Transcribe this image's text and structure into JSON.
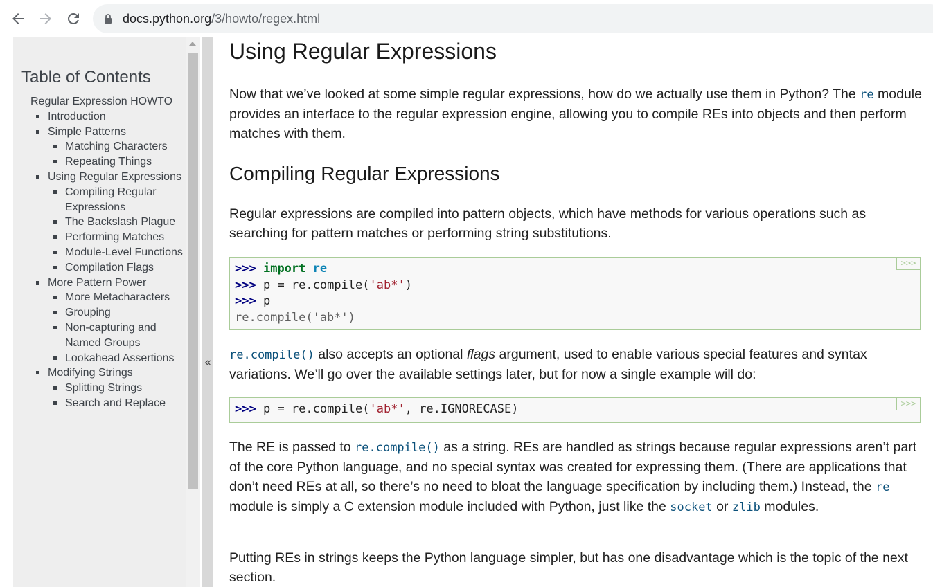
{
  "browser": {
    "url_domain": "docs.python.org",
    "url_path": "/3/howto/regex.html"
  },
  "sidebar": {
    "title": "Table of Contents",
    "items": [
      {
        "level": 0,
        "label": "Regular Expression HOWTO"
      },
      {
        "level": 1,
        "label": "Introduction"
      },
      {
        "level": 1,
        "label": "Simple Patterns"
      },
      {
        "level": 2,
        "label": "Matching Characters"
      },
      {
        "level": 2,
        "label": "Repeating Things"
      },
      {
        "level": 1,
        "label": "Using Regular Expressions"
      },
      {
        "level": 2,
        "label": "Compiling Regular Expressions"
      },
      {
        "level": 2,
        "label": "The Backslash Plague"
      },
      {
        "level": 2,
        "label": "Performing Matches"
      },
      {
        "level": 2,
        "label": "Module-Level Functions"
      },
      {
        "level": 2,
        "label": "Compilation Flags"
      },
      {
        "level": 1,
        "label": "More Pattern Power"
      },
      {
        "level": 2,
        "label": "More Metacharacters"
      },
      {
        "level": 2,
        "label": "Grouping"
      },
      {
        "level": 2,
        "label": "Non-capturing and Named Groups"
      },
      {
        "level": 2,
        "label": "Lookahead Assertions"
      },
      {
        "level": 1,
        "label": "Modifying Strings"
      },
      {
        "level": 2,
        "label": "Splitting Strings"
      },
      {
        "level": 2,
        "label": "Search and Replace"
      }
    ],
    "collapse_label": "«"
  },
  "main": {
    "h1": "Using Regular Expressions",
    "p1_before": "Now that we’ve looked at some simple regular expressions, how do we actually use them in Python? The ",
    "p1_code": "re",
    "p1_after": " module provides an interface to the regular expression engine, allowing you to compile REs into objects and then perform matches with them.",
    "h2": "Compiling Regular Expressions",
    "p2": "Regular expressions are compiled into pattern objects, which have methods for various operations such as searching for pattern matches or performing string substitutions.",
    "code1": {
      "prompt": ">>>",
      "line1_kw": "import",
      "line1_mod": "re",
      "line2_a": "p = re.compile(",
      "line2_str": "'ab*'",
      "line2_b": ")",
      "line3": "p",
      "line4": "re.compile('ab*')"
    },
    "copy_label": ">>>",
    "p3_code": "re.compile()",
    "p3_a": " also accepts an optional ",
    "p3_em": "flags",
    "p3_b": " argument, used to enable various special features and syntax variations. We’ll go over the available settings later, but for now a single example will do:",
    "code2": {
      "prompt": ">>>",
      "line_a": "p = re.compile(",
      "line_str": "'ab*'",
      "line_b": ", re.IGNORECASE)"
    },
    "p4_a": "The RE is passed to ",
    "p4_code1": "re.compile()",
    "p4_b": " as a string. REs are handled as strings because regular expressions aren’t part of the core Python language, and no special syntax was created for expressing them. (There are applications that don’t need REs at all, so there’s no need to bloat the language specification by including them.) Instead, the ",
    "p4_code2": "re",
    "p4_c": " module is simply a C extension module included with Python, just like the ",
    "p4_code3": "socket",
    "p4_d": " or ",
    "p4_code4": "zlib",
    "p4_e": " modules.",
    "p5": "Putting REs in strings keeps the Python language simpler, but has one disadvantage which is the topic of the next section."
  }
}
